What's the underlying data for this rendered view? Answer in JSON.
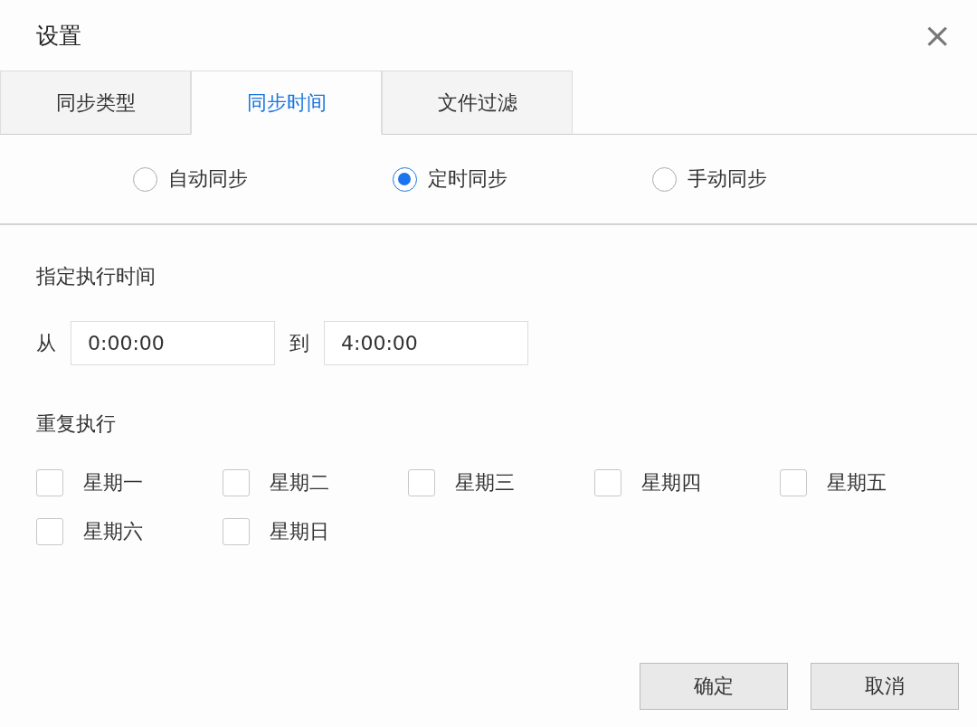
{
  "window": {
    "title": "设置",
    "close": "×"
  },
  "tabs": [
    {
      "label": "同步类型",
      "selected": false
    },
    {
      "label": "同步时间",
      "selected": true
    },
    {
      "label": "文件过滤",
      "selected": false
    }
  ],
  "sync_modes": [
    {
      "label": "自动同步",
      "selected": false
    },
    {
      "label": "定时同步",
      "selected": true
    },
    {
      "label": "手动同步",
      "selected": false
    }
  ],
  "schedule": {
    "heading": "指定执行时间",
    "from_label": "从",
    "from_value": "0:00:00",
    "to_label": "到",
    "to_value": "4:00:00"
  },
  "repeat": {
    "heading": "重复执行",
    "days": [
      {
        "label": "星期一",
        "checked": false
      },
      {
        "label": "星期二",
        "checked": false
      },
      {
        "label": "星期三",
        "checked": false
      },
      {
        "label": "星期四",
        "checked": false
      },
      {
        "label": "星期五",
        "checked": false
      },
      {
        "label": "星期六",
        "checked": false
      },
      {
        "label": "星期日",
        "checked": false
      }
    ]
  },
  "buttons": [
    "确定",
    "取消"
  ]
}
